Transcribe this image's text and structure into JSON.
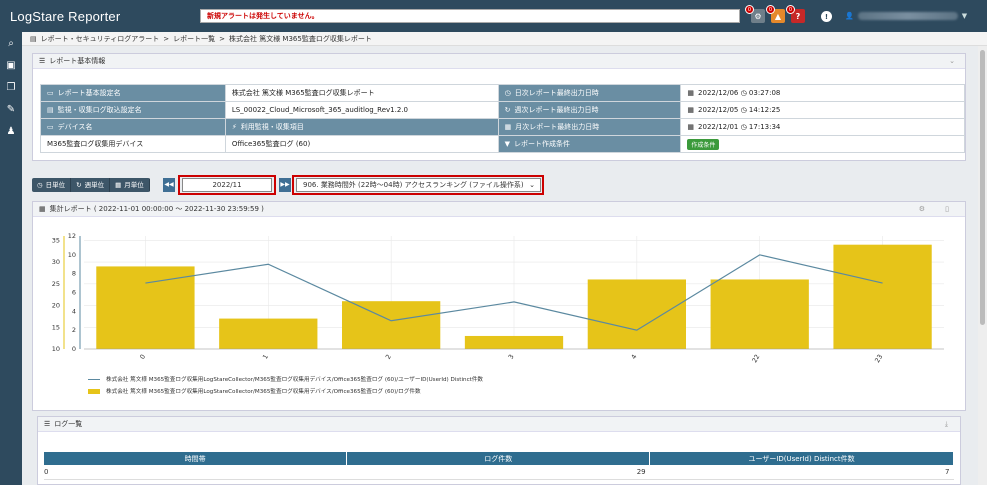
{
  "app": {
    "title": "LogStare Reporter",
    "alert_text": "新規アラートは発生していません。",
    "badges": [
      "0",
      "0",
      "0"
    ],
    "user_caret": "▼"
  },
  "breadcrumb": [
    "レポート・セキュリティログアラート",
    ">",
    "レポート一覧",
    ">",
    "株式会社 篤文様 M365監査ログ収集レポート"
  ],
  "info_panel": {
    "title": "レポート基本情報",
    "rows": [
      [
        {
          "type": "lbl",
          "icon": "▭",
          "text": "レポート基本設定名"
        },
        {
          "type": "val",
          "text": "株式会社 篤文様 M365監査ログ収集レポート"
        },
        {
          "type": "lbl",
          "icon": "◷",
          "text": "日次レポート最終出力日時"
        },
        {
          "type": "val",
          "icon": "▦",
          "text": "2022/12/06 ◷ 03:27:08"
        }
      ],
      [
        {
          "type": "lbl",
          "icon": "▤",
          "text": "監視・収集ログ取込設定名"
        },
        {
          "type": "val",
          "text": "LS_00022_Cloud_Microsoft_365_auditlog_Rev1.2.0"
        },
        {
          "type": "lbl",
          "icon": "↻",
          "text": "週次レポート最終出力日時"
        },
        {
          "type": "val",
          "icon": "▦",
          "text": "2022/12/05 ◷ 14:12:25"
        }
      ],
      [
        {
          "type": "lbl",
          "icon": "▭",
          "text": "デバイス名"
        },
        {
          "type": "lbl",
          "icon": "⚡",
          "text": "利用監視・収集項目"
        },
        {
          "type": "lbl",
          "icon": "▦",
          "text": "月次レポート最終出力日時"
        },
        {
          "type": "val",
          "icon": "▦",
          "text": "2022/12/01 ◷ 17:13:34"
        }
      ],
      [
        {
          "type": "val",
          "text": "M365監査ログ収集用デバイス"
        },
        {
          "type": "val",
          "text": "Office365監査ログ (60)"
        },
        {
          "type": "lbl",
          "icon": "▼",
          "text": "レポート作成条件"
        },
        {
          "type": "btn",
          "icon": "⊕",
          "text": "作成条件"
        }
      ]
    ]
  },
  "controls": {
    "segments": [
      {
        "icon": "◷",
        "label": "日単位"
      },
      {
        "icon": "↻",
        "label": "週単位"
      },
      {
        "icon": "▦",
        "label": "月単位"
      }
    ],
    "prev": "◀◀",
    "next": "▶▶",
    "date_value": "2022/11",
    "select_value": "906. 業務時間外 (22時〜04時) アクセスランキング (ファイル操作系)"
  },
  "report_panel": {
    "title": "集計レポート ( 2022-11-01 00:00:00 ～ 2022-11-30 23:59:59 )"
  },
  "chart_data": {
    "type": "bar",
    "categories": [
      "0",
      "1",
      "2",
      "3",
      "4",
      "22",
      "23"
    ],
    "series": [
      {
        "name": "株式会社 篤文様 M365監査ログ収集用LogStareCollector/M365監査ログ収集用デバイス/Office365監査ログ (60)/ユーザーID(UserId) Distinct件数",
        "type": "line",
        "axis": "right",
        "color": "#5b89a0",
        "values": [
          7,
          9,
          3,
          5,
          2,
          10,
          7
        ]
      },
      {
        "name": "株式会社 篤文様 M365監査ログ収集用LogStareCollector/M365監査ログ収集用デバイス/Office365監査ログ (60)/ログ件数",
        "type": "bar",
        "axis": "left",
        "color": "#e6c419",
        "values": [
          29,
          17,
          21,
          13,
          26,
          26,
          34
        ]
      }
    ],
    "y_left": {
      "ticks": [
        10,
        15,
        20,
        25,
        30,
        35
      ],
      "ylim": [
        10,
        36
      ]
    },
    "y_right": {
      "ticks": [
        0,
        2,
        4,
        6,
        8,
        10,
        12
      ],
      "ylim": [
        0,
        12
      ]
    },
    "grid": true,
    "legend": "bottom-left"
  },
  "log_panel": {
    "title": "ログ一覧",
    "headers": [
      "時間帯",
      "ログ件数",
      "ユーザーID(UserId) Distinct件数"
    ],
    "rows": [
      [
        "0",
        "29",
        "7"
      ]
    ]
  },
  "colors": {
    "topbar": "#2e4a5e",
    "label": "#6a8ea3",
    "bar": "#e6c419",
    "line": "#5b89a0",
    "highlight": "#cc0000"
  }
}
